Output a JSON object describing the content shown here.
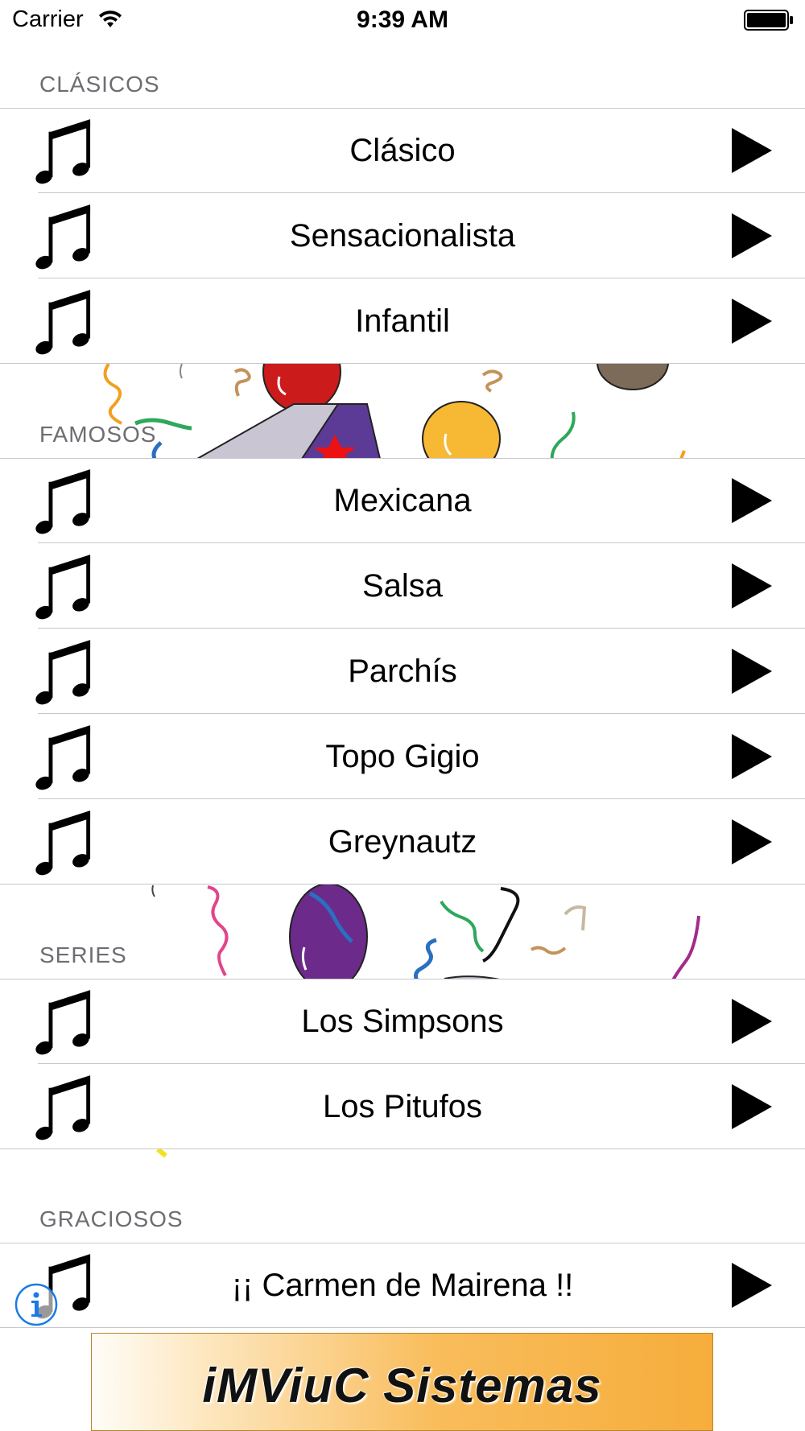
{
  "status_bar": {
    "carrier": "Carrier",
    "time": "9:39 AM"
  },
  "sections": [
    {
      "title": "CLÁSICOS",
      "items": [
        "Clásico",
        "Sensacionalista",
        "Infantil"
      ]
    },
    {
      "title": "FAMOSOS",
      "items": [
        "Mexicana",
        "Salsa",
        "Parchís",
        "Topo Gigio",
        "Greynautz"
      ]
    },
    {
      "title": "SERIES",
      "items": [
        "Los Simpsons",
        "Los Pitufos"
      ]
    },
    {
      "title": "GRACIOSOS",
      "items": [
        "¡¡ Carmen de Mairena !!"
      ]
    }
  ],
  "banner": {
    "text": "iMViuC Sistemas"
  },
  "icons": {
    "row_icon": "music-note-icon",
    "action_icon": "play-icon",
    "info_icon": "info-icon"
  },
  "colors": {
    "section_text": "#6d6d72",
    "separator": "#c8c7cc",
    "info_blue": "#1a7ae6",
    "banner_orange": "#f6ad3b"
  }
}
